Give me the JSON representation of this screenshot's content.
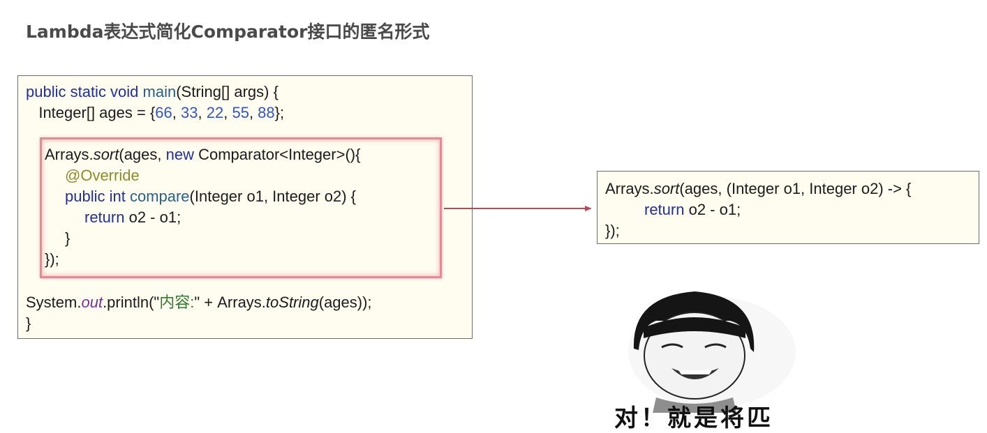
{
  "title": "Lambda表达式简化Comparator接口的匿名形式",
  "left_code": {
    "line1": {
      "kw": "public static void ",
      "fn": "main",
      "rest": "(String[] args) {"
    },
    "line2": {
      "pre": "   Integer[] ages = {",
      "n1": "66",
      "c1": ", ",
      "n2": "33",
      "c2": ", ",
      "n3": "22",
      "c3": ", ",
      "n4": "55",
      "c4": ", ",
      "n5": "88",
      "post": "};"
    },
    "line3": {
      "pre": "Arrays.",
      "it": "sort",
      "mid": "(ages, ",
      "kw": "new",
      "post": " Comparator<Integer>(){"
    },
    "line4": {
      "ann": "@Override"
    },
    "line5": {
      "kw": "public int ",
      "fn": "compare",
      "rest": "(Integer o1, Integer o2) {"
    },
    "line6": {
      "kw": "return",
      "rest": " o2 - o1;"
    },
    "line7": "}",
    "line8": "});",
    "line9": {
      "pre": "System.",
      "field": "out",
      "mid": ".println(\"",
      "str": "内容:",
      "mid2": "\" + Arrays.",
      "it": "toString",
      "post": "(ages));"
    },
    "line10": "}"
  },
  "right_code": {
    "line1": {
      "pre": "Arrays.",
      "it": "sort",
      "post": "(ages, (Integer o1, Integer o2) -> {"
    },
    "line2": {
      "kw": "return",
      "rest": " o2 - o1;"
    },
    "line3": "});"
  },
  "meme_caption": "对！就是将匹",
  "colors": {
    "keyword": "#1f2fa0",
    "number": "#2f57c9",
    "annotation": "#8c8c2b",
    "highlight": "#e38a96",
    "arrow": "#b84a57"
  }
}
